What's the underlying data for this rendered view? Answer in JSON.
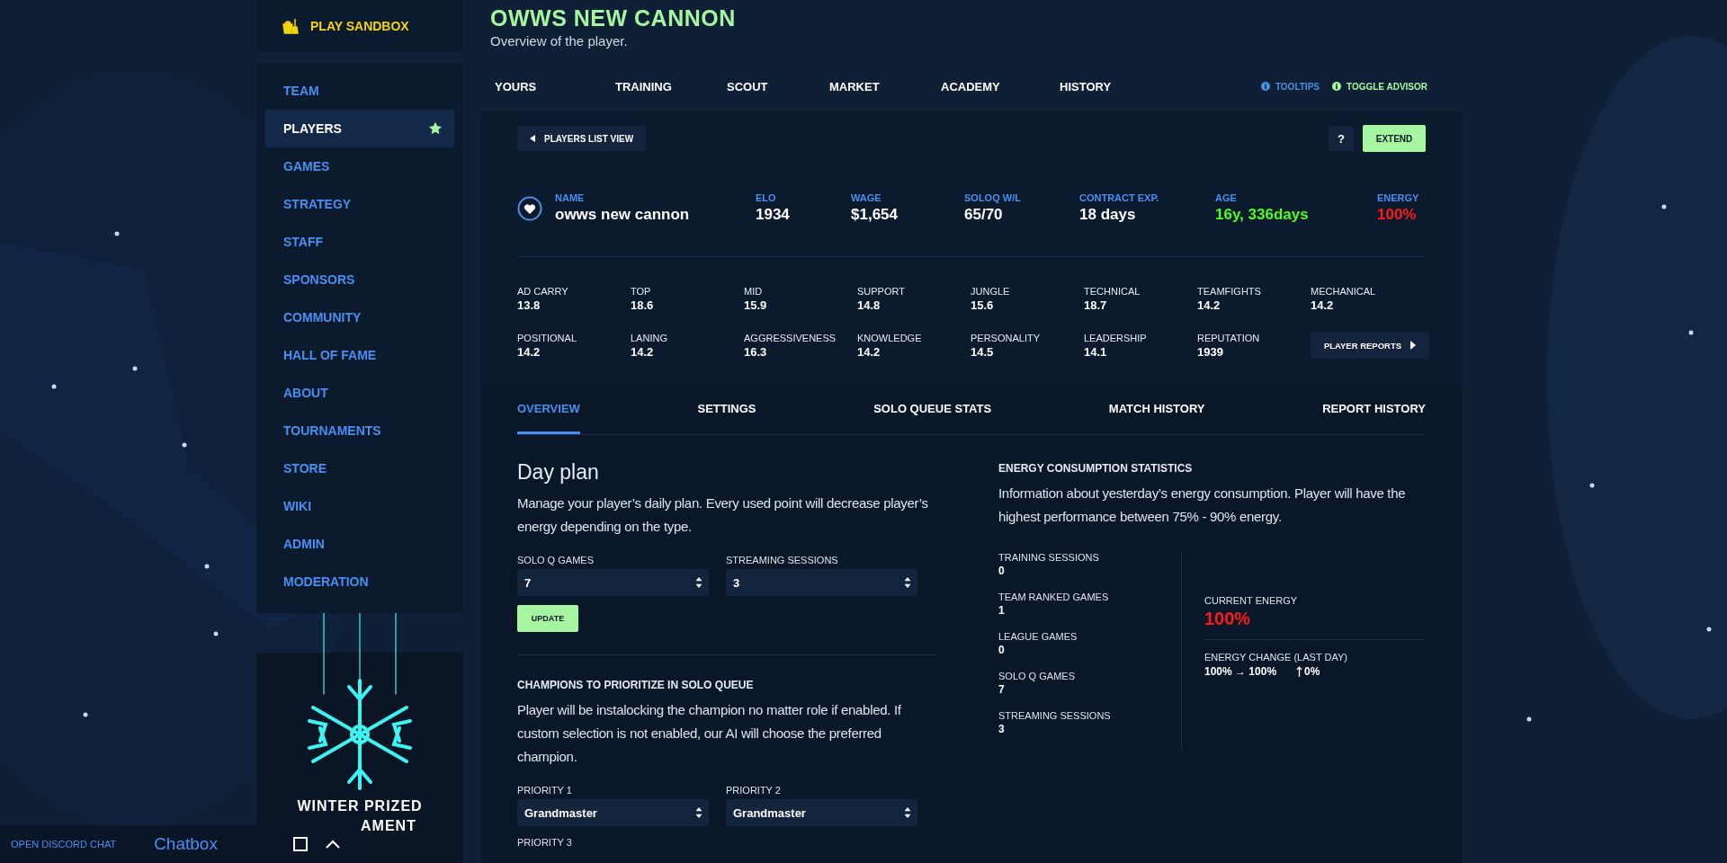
{
  "sidebar": {
    "sandbox": "PLAY SANDBOX",
    "items": [
      {
        "label": "TEAM",
        "selected": false,
        "starred": false
      },
      {
        "label": "PLAYERS",
        "selected": true,
        "starred": true
      },
      {
        "label": "GAMES",
        "selected": false,
        "starred": false
      },
      {
        "label": "STRATEGY",
        "selected": false,
        "starred": false
      },
      {
        "label": "STAFF",
        "selected": false,
        "starred": false
      },
      {
        "label": "SPONSORS",
        "selected": false,
        "starred": false
      },
      {
        "label": "COMMUNITY",
        "selected": false,
        "starred": false
      },
      {
        "label": "HALL OF FAME",
        "selected": false,
        "starred": false
      },
      {
        "label": "ABOUT",
        "selected": false,
        "starred": false
      },
      {
        "label": "TOURNAMENTS",
        "selected": false,
        "starred": false
      },
      {
        "label": "STORE",
        "selected": false,
        "starred": false
      },
      {
        "label": "WIKI",
        "selected": false,
        "starred": false
      },
      {
        "label": "ADMIN",
        "selected": false,
        "starred": false
      },
      {
        "label": "MODERATION",
        "selected": false,
        "starred": false
      }
    ]
  },
  "banner": {
    "lines": [
      "WINTER PRIZED",
      "AMENT"
    ]
  },
  "chat_bar": {
    "discord_link": "OPEN DISCORD CHAT",
    "title": "Chatbox"
  },
  "header": {
    "title": "OWWS NEW CANNON",
    "subtitle": "Overview of the player."
  },
  "top_tabs": [
    "YOURS",
    "TRAINING",
    "SCOUT",
    "MARKET",
    "ACADEMY",
    "HISTORY"
  ],
  "help_links": [
    {
      "label": "TOOLTIPS",
      "color": "#4a90e2"
    },
    {
      "label": "TOGGLE ADVISOR",
      "color": "#a6f5a0"
    }
  ],
  "toolbar": {
    "back_button": "PLAYERS LIST VIEW",
    "help_button": "?",
    "extend_button": "EXTEND"
  },
  "player": [
    {
      "label": "NAME",
      "value": "owws new cannon",
      "color": "#ffffff"
    },
    {
      "label": "ELO",
      "value": "1934",
      "color": "#ffffff"
    },
    {
      "label": "WAGE",
      "value": "$1,654",
      "color": "#ffffff"
    },
    {
      "label": "SOLOQ W/L",
      "value": "65/70",
      "color": "#ffffff"
    },
    {
      "label": "CONTRACT EXP.",
      "value": "18 days",
      "color": "#ffffff"
    },
    {
      "label": "AGE",
      "value": "16y, 336days",
      "color": "#4cff1e"
    },
    {
      "label": "ENERGY",
      "value": "100%",
      "color": "#ff1a1a"
    }
  ],
  "attributes": [
    {
      "label": "AD CARRY",
      "value": "13.8"
    },
    {
      "label": "TOP",
      "value": "18.6"
    },
    {
      "label": "MID",
      "value": "15.9"
    },
    {
      "label": "SUPPORT",
      "value": "14.8"
    },
    {
      "label": "JUNGLE",
      "value": "15.6"
    },
    {
      "label": "TECHNICAL",
      "value": "18.7"
    },
    {
      "label": "TEAMFIGHTS",
      "value": "14.2"
    },
    {
      "label": "MECHANICAL",
      "value": "14.2"
    },
    {
      "label": "POSITIONAL",
      "value": "14.2"
    },
    {
      "label": "LANING",
      "value": "14.2"
    },
    {
      "label": "AGGRESSIVENESS",
      "value": "16.3"
    },
    {
      "label": "KNOWLEDGE",
      "value": "14.2"
    },
    {
      "label": "PERSONALITY",
      "value": "14.5"
    },
    {
      "label": "LEADERSHIP",
      "value": "14.1"
    },
    {
      "label": "REPUTATION",
      "value": "1939"
    }
  ],
  "reports_button": "PLAYER REPORTS",
  "detail_tabs": [
    {
      "label": "OVERVIEW",
      "selected": true
    },
    {
      "label": "SETTINGS",
      "selected": false
    },
    {
      "label": "SOLO QUEUE STATS",
      "selected": false
    },
    {
      "label": "MATCH HISTORY",
      "selected": false
    },
    {
      "label": "REPORT HISTORY",
      "selected": false
    }
  ],
  "day_plan": {
    "heading": "Day plan",
    "description": "Manage your player’s daily plan. Every used point will decrease player’s energy depending on the type.",
    "fields": [
      {
        "label": "SOLO Q GAMES",
        "value": "7"
      },
      {
        "label": "STREAMING SESSIONS",
        "value": "3"
      }
    ],
    "update_button": "UPDATE"
  },
  "champions": {
    "heading": "CHAMPIONS TO PRIORITIZE IN SOLO QUEUE",
    "description": "Player will be instalocking the champion no matter role if enabled. If custom selection is not enabled, our AI will choose the preferred champion.",
    "priorities": [
      {
        "label": "PRIORITY 1",
        "value": "Grandmaster"
      },
      {
        "label": "PRIORITY 2",
        "value": "Grandmaster"
      },
      {
        "label": "PRIORITY 3"
      }
    ]
  },
  "energy": {
    "heading": "ENERGY CONSUMPTION STATISTICS",
    "description": "Information about yesterday’s energy consumption. Player will have the highest performance between 75% - 90% energy.",
    "counts": [
      {
        "label": "TRAINING SESSIONS",
        "value": "0"
      },
      {
        "label": "TEAM RANKED GAMES",
        "value": "1"
      },
      {
        "label": "LEAGUE GAMES",
        "value": "0"
      },
      {
        "label": "SOLO Q GAMES",
        "value": "7"
      },
      {
        "label": "STREAMING SESSIONS",
        "value": "3"
      }
    ],
    "current": {
      "label": "CURRENT ENERGY",
      "value": "100%"
    },
    "change": {
      "label": "ENERGY CHANGE (LAST DAY)",
      "value": "100% → 100%",
      "delta": "0%"
    }
  }
}
